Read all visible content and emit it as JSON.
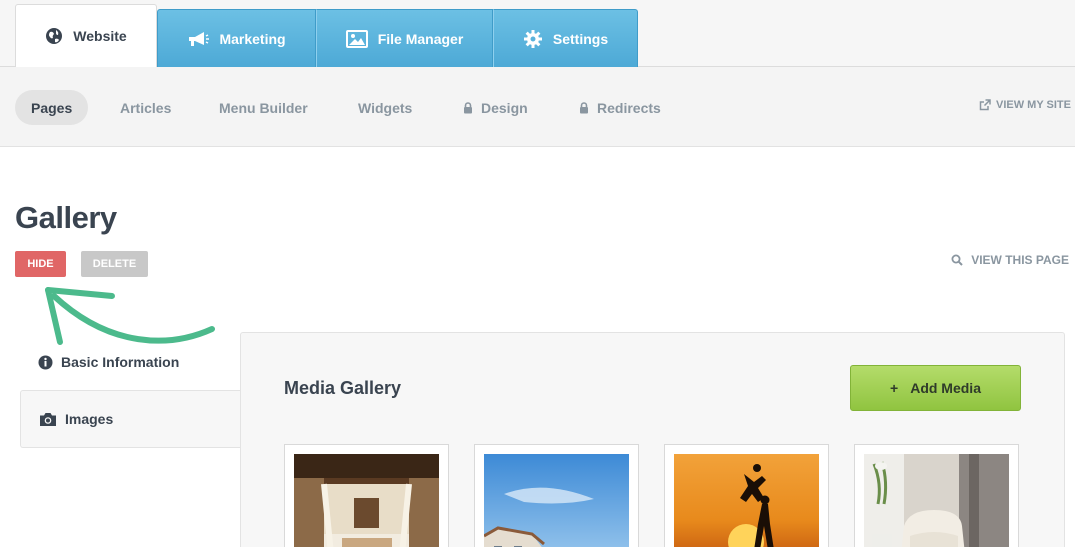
{
  "top_tabs": [
    {
      "label": "Website",
      "icon": "globe-icon"
    },
    {
      "label": "Marketing",
      "icon": "megaphone-icon"
    },
    {
      "label": "File Manager",
      "icon": "image-icon"
    },
    {
      "label": "Settings",
      "icon": "gear-icon"
    }
  ],
  "sub_nav": {
    "items": [
      {
        "label": "Pages"
      },
      {
        "label": "Articles"
      },
      {
        "label": "Menu Builder"
      },
      {
        "label": "Widgets"
      },
      {
        "label": "Design",
        "icon": "lock-icon"
      },
      {
        "label": "Redirects",
        "icon": "lock-icon"
      }
    ],
    "view_site": "VIEW MY SITE"
  },
  "page": {
    "title": "Gallery",
    "hide_label": "HIDE",
    "delete_label": "DELETE",
    "view_page": "VIEW THIS PAGE"
  },
  "left_nav": [
    {
      "label": "Basic Information",
      "icon": "info-icon"
    },
    {
      "label": "Images",
      "icon": "camera-icon"
    }
  ],
  "media": {
    "title": "Media Gallery",
    "add_label": "Add Media",
    "add_icon": "+"
  },
  "colors": {
    "tab_blue": "#5ab2dc",
    "hide_red": "#e06666",
    "delete_gray": "#c8c8c8",
    "add_green": "#a2d055",
    "arrow_green": "#4cba8c"
  }
}
